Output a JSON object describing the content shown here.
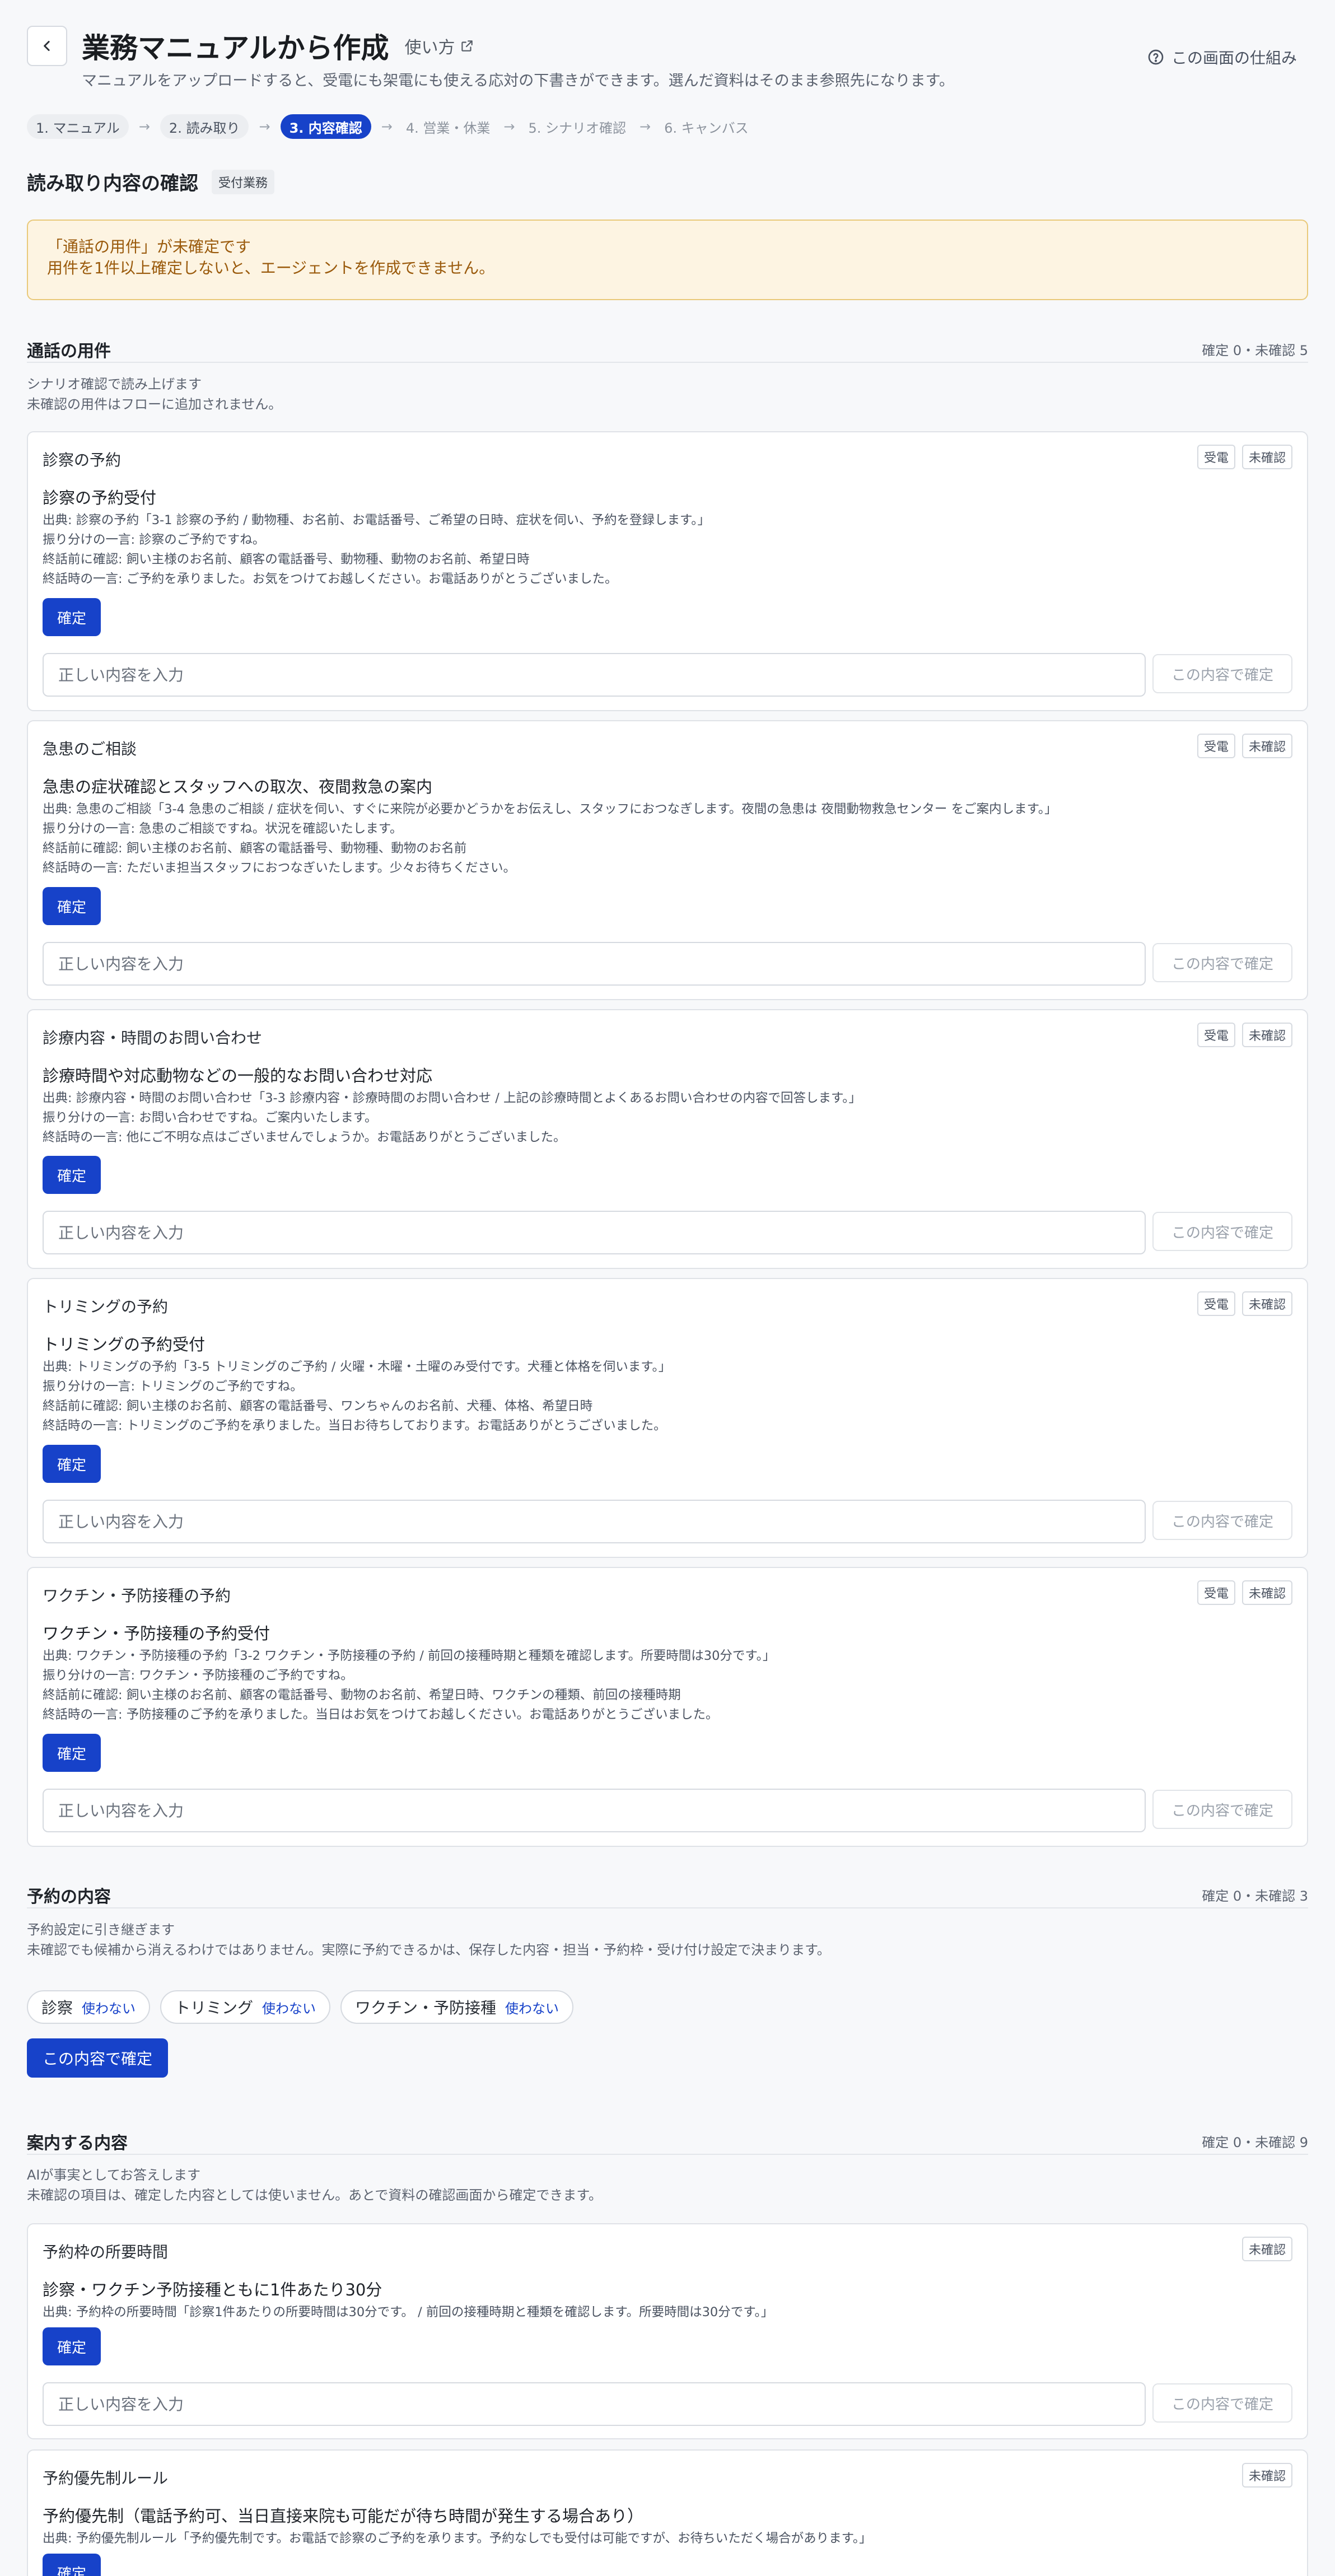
{
  "header": {
    "title": "業務マニュアルから作成",
    "howto": "使い方",
    "subtitle": "マニュアルをアップロードすると、受電にも架電にも使える応対の下書きができます。選んだ資料はそのまま参照先になります。",
    "help": "この画面の仕組み"
  },
  "steps": [
    {
      "label": "1. マニュアル",
      "state": "done"
    },
    {
      "label": "2. 読み取り",
      "state": "done"
    },
    {
      "label": "3. 内容確認",
      "state": "active"
    },
    {
      "label": "4. 営業・休業",
      "state": "todo"
    },
    {
      "label": "5. シナリオ確認",
      "state": "todo"
    },
    {
      "label": "6. キャンバス",
      "state": "todo"
    }
  ],
  "section": {
    "title": "読み取り内容の確認",
    "badge": "受付業務"
  },
  "warning": {
    "line1": "「通話の用件」が未確定です",
    "line2": "用件を1件以上確定しないと、エージェントを作成できません。"
  },
  "common": {
    "confirm": "確定",
    "placeholder": "正しい内容を入力",
    "confirm_this": "この内容で確定",
    "tag_inbound": "受電",
    "tag_unconfirmed": "未確認"
  },
  "group_purposes": {
    "title": "通話の用件",
    "count": "確定 0・未確認 5",
    "note1": "シナリオ確認で読み上げます",
    "note2": "未確認の用件はフローに追加されません。",
    "cards": [
      {
        "title": "診察の予約",
        "head": "診察の予約受付",
        "lines": [
          "出典: 診察の予約「3-1 診察の予約 / 動物種、お名前、お電話番号、ご希望の日時、症状を伺い、予約を登録します。」",
          "振り分けの一言: 診察のご予約ですね。",
          "終話前に確認: 飼い主様のお名前、顧客の電話番号、動物種、動物のお名前、希望日時",
          "終話時の一言: ご予約を承りました。お気をつけてお越しください。お電話ありがとうございました。"
        ]
      },
      {
        "title": "急患のご相談",
        "head": "急患の症状確認とスタッフへの取次、夜間救急の案内",
        "lines": [
          "出典: 急患のご相談「3-4 急患のご相談 / 症状を伺い、すぐに来院が必要かどうかをお伝えし、スタッフにおつなぎします。夜間の急患は 夜間動物救急センター をご案内します。」",
          "振り分けの一言: 急患のご相談ですね。状況を確認いたします。",
          "終話前に確認: 飼い主様のお名前、顧客の電話番号、動物種、動物のお名前",
          "終話時の一言: ただいま担当スタッフにおつなぎいたします。少々お待ちください。"
        ]
      },
      {
        "title": "診療内容・時間のお問い合わせ",
        "head": "診療時間や対応動物などの一般的なお問い合わせ対応",
        "lines": [
          "出典: 診療内容・時間のお問い合わせ「3-3 診療内容・診療時間のお問い合わせ / 上記の診療時間とよくあるお問い合わせの内容で回答します。」",
          "振り分けの一言: お問い合わせですね。ご案内いたします。",
          "終話時の一言: 他にご不明な点はございませんでしょうか。お電話ありがとうございました。"
        ]
      },
      {
        "title": "トリミングの予約",
        "head": "トリミングの予約受付",
        "lines": [
          "出典: トリミングの予約「3-5 トリミングのご予約 / 火曜・木曜・土曜のみ受付です。犬種と体格を伺います。」",
          "振り分けの一言: トリミングのご予約ですね。",
          "終話前に確認: 飼い主様のお名前、顧客の電話番号、ワンちゃんのお名前、犬種、体格、希望日時",
          "終話時の一言: トリミングのご予約を承りました。当日お待ちしております。お電話ありがとうございました。"
        ]
      },
      {
        "title": "ワクチン・予防接種の予約",
        "head": "ワクチン・予防接種の予約受付",
        "lines": [
          "出典: ワクチン・予防接種の予約「3-2 ワクチン・予防接種の予約 / 前回の接種時期と種類を確認します。所要時間は30分です。」",
          "振り分けの一言: ワクチン・予防接種のご予約ですね。",
          "終話前に確認: 飼い主様のお名前、顧客の電話番号、動物のお名前、希望日時、ワクチンの種類、前回の接種時期",
          "終話時の一言: 予防接種のご予約を承りました。当日はお気をつけてお越しください。お電話ありがとうございました。"
        ]
      }
    ]
  },
  "group_booking": {
    "title": "予約の内容",
    "count": "確定 0・未確認 3",
    "note1": "予約設定に引き継ぎます",
    "note2": "未確認でも候補から消えるわけではありません。実際に予約できるかは、保存した内容・担当・予約枠・受け付け設定で決まります。",
    "chips": [
      {
        "label": "診察",
        "action": "使わない"
      },
      {
        "label": "トリミング",
        "action": "使わない"
      },
      {
        "label": "ワクチン・予防接種",
        "action": "使わない"
      }
    ],
    "confirm_btn": "この内容で確定"
  },
  "group_guidance": {
    "title": "案内する内容",
    "count": "確定 0・未確認 9",
    "note1": "AIが事実としてお答えします",
    "note2": "未確認の項目は、確定した内容としては使いません。あとで資料の確認画面から確定できます。",
    "cards": [
      {
        "title": "予約枠の所要時間",
        "head": "診察・ワクチン予防接種ともに1件あたり30分",
        "lines": [
          "出典: 予約枠の所要時間「診察1件あたりの所要時間は30分です。 / 前回の接種時期と種類を確認します。所要時間は30分です。」"
        ]
      },
      {
        "title": "予約優先制ルール",
        "head": "予約優先制（電話予約可、当日直接来院も可能だが待ち時間が発生する場合あり）",
        "lines": [
          "出典: 予約優先制ルール「予約優先制です。お電話で診察のご予約を承ります。予約なしでも受付は可能ですが、お待ちいただく場合があります。」"
        ]
      }
    ]
  }
}
